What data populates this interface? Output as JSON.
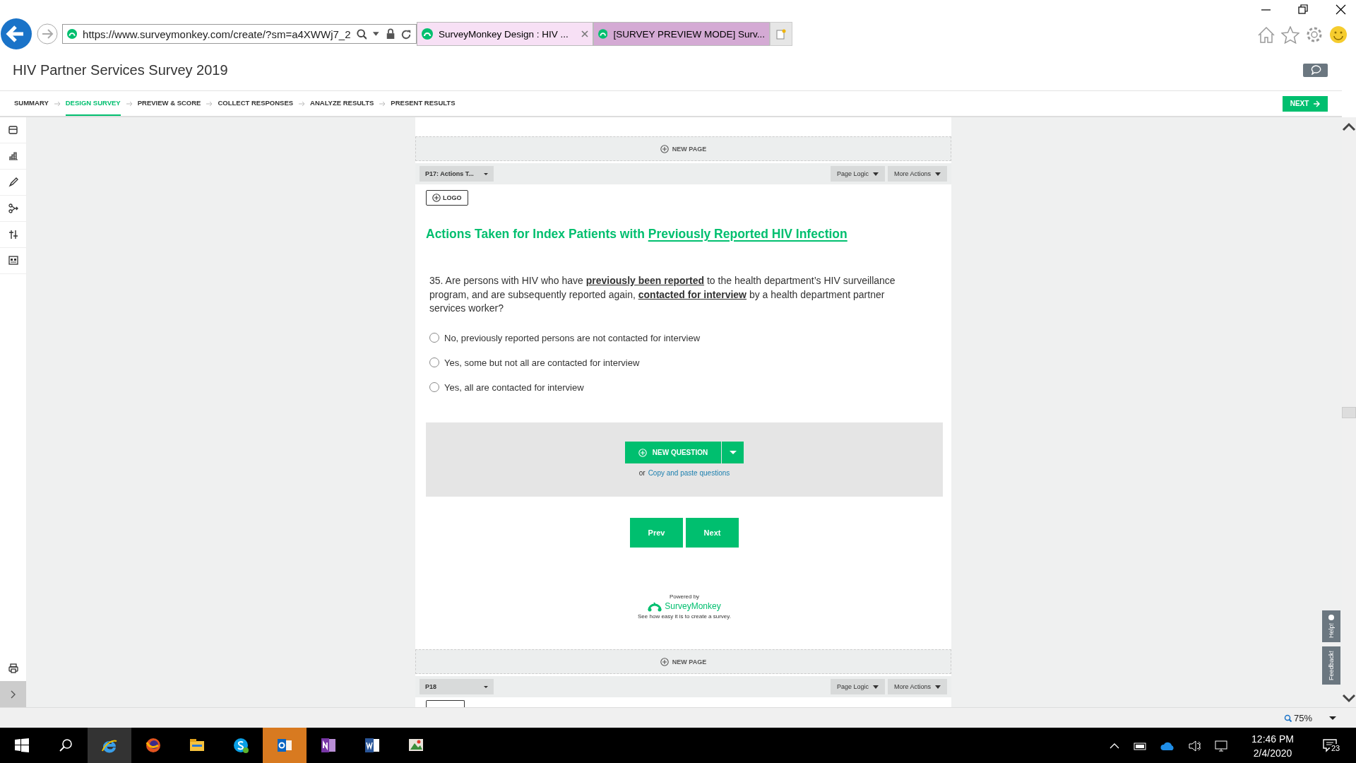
{
  "browser": {
    "url": "https://www.surveymonkey.com/create/?sm=a4XWWj7_2",
    "tabs": [
      {
        "title": "SurveyMonkey Design : HIV ...",
        "selected": true
      },
      {
        "title": "[SURVEY PREVIEW MODE] Surv...",
        "selected": false
      }
    ]
  },
  "app": {
    "title": "HIV Partner Services Survey 2019",
    "steps": [
      {
        "label": "SUMMARY",
        "selected": false
      },
      {
        "label": "DESIGN SURVEY",
        "selected": true
      },
      {
        "label": "PREVIEW & SCORE",
        "selected": false
      },
      {
        "label": "COLLECT RESPONSES",
        "selected": false
      },
      {
        "label": "ANALYZE RESULTS",
        "selected": false
      },
      {
        "label": "PRESENT RESULTS",
        "selected": false
      }
    ],
    "next_button": "NEXT"
  },
  "pages": [
    {
      "new_page": "NEW PAGE",
      "page_select": "P17: Actions T...",
      "page_logic": "Page Logic",
      "more_actions": "More Actions"
    },
    {
      "new_page": "NEW PAGE",
      "page_select": "P18",
      "page_logic": "Page Logic",
      "more_actions": "More Actions"
    }
  ],
  "logo_button": "LOGO",
  "heading": {
    "text": "Actions Taken for Index Patients with",
    "underlined": "Previously Reported HIV Infection"
  },
  "question": {
    "text": "35. Are persons with HIV who have **previously been reported** to the health department’s HIV surveillance program, and are subsequently reported again, **contacted for interview**  by a health department partner services worker?",
    "options": [
      {
        "label": "No, previously reported persons are not contacted for interview",
        "selected": false
      },
      {
        "label": "Yes, some but not all are contacted for interview",
        "selected": false
      },
      {
        "label": "Yes, all are contacted for interview",
        "selected": false
      }
    ]
  },
  "add_question": {
    "button": "NEW QUESTION",
    "or_text": "or",
    "link": "Copy and paste questions"
  },
  "nav_buttons": [
    "Prev",
    "Next"
  ],
  "footer": {
    "powered_by": "Powered by",
    "brand": "SurveyMonkey",
    "tagline": "See how easy it is to",
    "link": "create a survey",
    "after_link": "."
  },
  "side_tabs": [
    "Help!",
    "Feedback!"
  ],
  "status_bar": {
    "zoom": "75%"
  },
  "taskbar": {
    "apps": [
      {
        "kind": "ie",
        "selected": true
      },
      {
        "kind": "firefox",
        "selected": false
      },
      {
        "kind": "explorer",
        "selected": false
      },
      {
        "kind": "skype",
        "selected": false
      },
      {
        "kind": "outlook",
        "selected": false,
        "attention": true
      },
      {
        "kind": "onenote",
        "selected": false
      },
      {
        "kind": "word",
        "selected": false
      },
      {
        "kind": "paint",
        "selected": false
      }
    ],
    "time": "12:46 PM",
    "date": "2/4/2020",
    "notifications": "23"
  }
}
